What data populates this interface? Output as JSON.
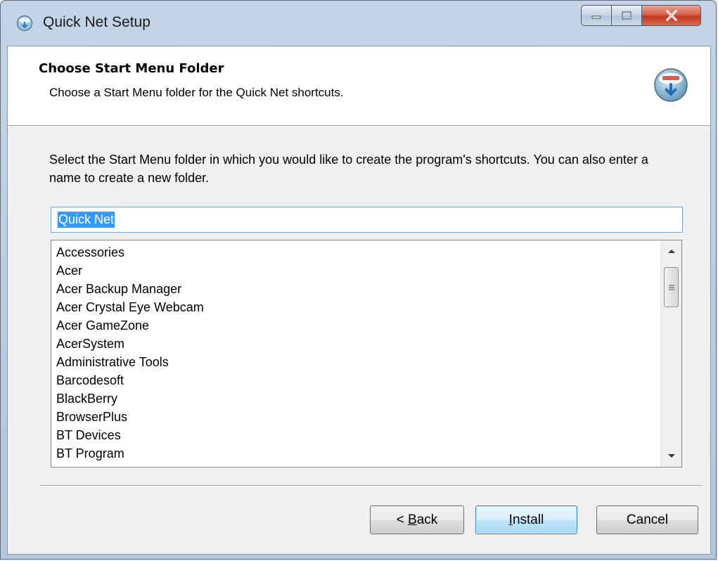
{
  "window": {
    "title": "Quick Net Setup"
  },
  "header": {
    "title": "Choose Start Menu Folder",
    "subtitle": "Choose a Start Menu folder for the Quick Net shortcuts."
  },
  "main": {
    "description": "Select the Start Menu folder in which you would like to create the program's shortcuts. You can also enter a name to create a new folder.",
    "folder_input": {
      "value": "Quick Net"
    },
    "folder_list": [
      "Accessories",
      "Acer",
      "Acer Backup Manager",
      "Acer Crystal Eye Webcam",
      "Acer GameZone",
      "AcerSystem",
      "Administrative Tools",
      "Barcodesoft",
      "BlackBerry",
      "BrowserPlus",
      "BT Devices",
      "BT Program"
    ]
  },
  "buttons": {
    "back": {
      "prefix": "< ",
      "accel": "B",
      "rest": "ack"
    },
    "install": {
      "prefix": "",
      "accel": "I",
      "rest": "nstall"
    },
    "cancel": "Cancel"
  },
  "icons": {
    "app": "installer-globe-icon",
    "header": "installer-globe-download-icon",
    "minimize": "minimize-icon",
    "maximize": "maximize-icon",
    "close": "close-icon",
    "scroll_up": "scroll-up-arrow-icon",
    "scroll_down": "scroll-down-arrow-icon"
  },
  "colors": {
    "selection": "#3399ff",
    "close_button": "#c4391f",
    "default_button_border": "#3c7fb1"
  }
}
